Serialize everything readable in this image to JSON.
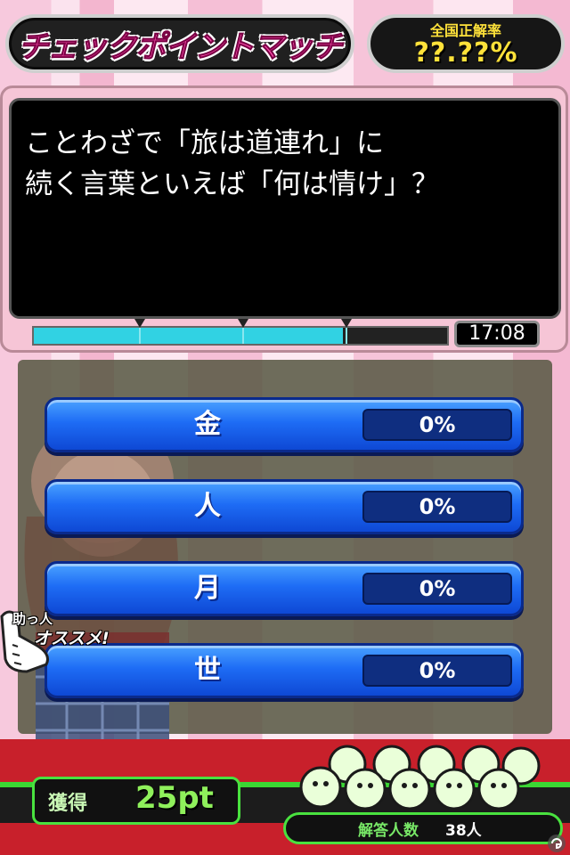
{
  "header": {
    "title": "チェックポイントマッチ",
    "rate_label": "全国正解率",
    "rate_value": "??.??%"
  },
  "question": {
    "line1": "ことわざで「旅は道連れ」に",
    "line2": "続く言葉といえば「何は情け」？",
    "timer": "17:08",
    "progress": 0.86
  },
  "answers": [
    {
      "label": "金",
      "pct": "0%"
    },
    {
      "label": "人",
      "pct": "0%"
    },
    {
      "label": "月",
      "pct": "0%"
    },
    {
      "label": "世",
      "pct": "0%"
    }
  ],
  "helper": {
    "top": "助っ人",
    "main": "オススメ!"
  },
  "footer": {
    "earn_label": "獲得",
    "earn_value": "25pt",
    "respondent_label": "解答人数",
    "respondent_count": "38人"
  },
  "colors": {
    "accent": "#ff4fb0",
    "timer_fill": "#31d2e3",
    "answer_blue": "#1e6cf5",
    "status_green": "#49e23f"
  }
}
